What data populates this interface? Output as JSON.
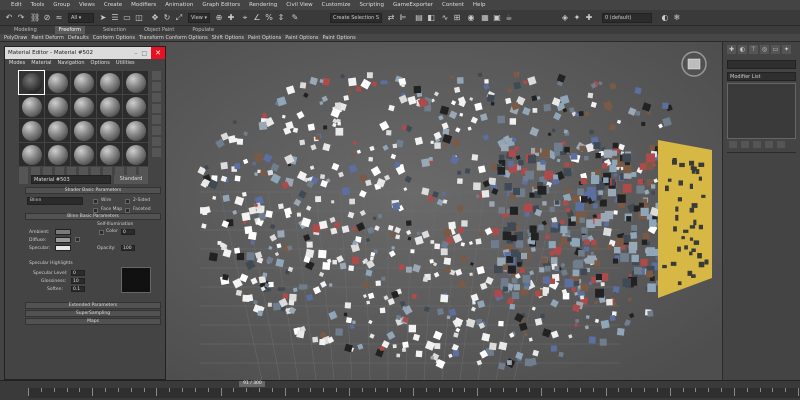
{
  "menubar": [
    "Edit",
    "Tools",
    "Group",
    "Views",
    "Create",
    "Modifiers",
    "Animation",
    "Graph Editors",
    "Rendering",
    "Civil View",
    "Customize",
    "Scripting",
    "GameExporter",
    "Content",
    "Help"
  ],
  "toolbar": {
    "selection_set_placeholder": "Create Selection S",
    "layer_label": "0 (default)"
  },
  "ribbon_tabs": [
    {
      "label": "Modeling",
      "active": false
    },
    {
      "label": "Freeform",
      "active": true
    },
    {
      "label": "Selection",
      "active": false
    },
    {
      "label": "Object Paint",
      "active": false
    },
    {
      "label": "Populate",
      "active": false
    }
  ],
  "ribbon_sub": [
    "PolyDraw",
    "Paint Deform",
    "Defaults",
    "Conform Options",
    "Transform Conform Options",
    "Shift Options",
    "Paint Options",
    "Paint Options",
    "Paint Options"
  ],
  "command_panel": {
    "modifier_list_label": "Modifier List"
  },
  "material_editor": {
    "title": "Material Editor - Material #502",
    "menu": [
      "Modes",
      "Material",
      "Navigation",
      "Options",
      "Utilities"
    ],
    "material_name": "Material #503",
    "material_type": "Standard",
    "shader_rollout": "Shader Basic Parameters",
    "shader_type": "Blinn",
    "options": {
      "wire": "Wire",
      "two_sided": "2-Sided",
      "face_map": "Face Map",
      "faceted": "Faceted"
    },
    "blinn_rollout": "Blinn Basic Parameters",
    "self_illumination": "Self-Illumination",
    "color_label": "Color",
    "color_value": "0",
    "ambient": "Ambient:",
    "diffuse": "Diffuse:",
    "specular": "Specular:",
    "opacity_label": "Opacity:",
    "opacity_value": "100",
    "specular_highlights": "Specular Highlights",
    "specular_level": "Specular Level:",
    "specular_level_value": "0",
    "glossiness": "Glossiness:",
    "glossiness_value": "10",
    "soften": "Soften:",
    "soften_value": "0.1",
    "extended_rollout": "Extended Parameters",
    "supersampling_rollout": "SuperSampling",
    "maps_rollout": "Maps"
  },
  "timeline": {
    "frame_label": "91 / 300",
    "current_frame": 91,
    "total_frames": 300
  }
}
